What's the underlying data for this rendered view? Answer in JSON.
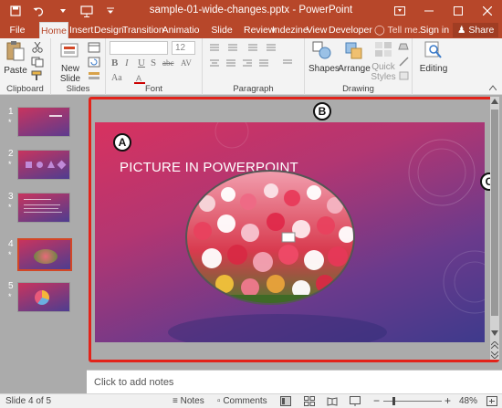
{
  "window": {
    "title": "sample-01-wide-changes.pptx - PowerPoint"
  },
  "tabs": [
    "File",
    "Home",
    "Insert",
    "Design",
    "Transition",
    "Animatio",
    "Slide Shov",
    "Review",
    "Indezine",
    "View",
    "Developer"
  ],
  "tell_me": "Tell me...",
  "sign_in": "Sign in",
  "share": "Share",
  "ribbon": {
    "paste": "Paste",
    "new_slide_line1": "New",
    "new_slide_line2": "Slide",
    "font_size": "12",
    "shapes": "Shapes",
    "arrange": "Arrange",
    "quick_styles_line1": "Quick",
    "quick_styles_line2": "Styles",
    "editing": "Editing",
    "groups": {
      "clipboard": "Clipboard",
      "slides": "Slides",
      "font": "Font",
      "paragraph": "Paragraph",
      "drawing": "Drawing"
    },
    "format_buttons": [
      "B",
      "I",
      "U",
      "S",
      "abc",
      "AV",
      "Aa"
    ]
  },
  "thumbnails": [
    {
      "number": "1",
      "star": "*"
    },
    {
      "number": "2",
      "star": "*"
    },
    {
      "number": "3",
      "star": "*"
    },
    {
      "number": "4",
      "star": "*"
    },
    {
      "number": "5",
      "star": "*"
    }
  ],
  "slide": {
    "title": "PICTURE IN POWERPOINT"
  },
  "callouts": {
    "a": "A",
    "b": "B",
    "c": "C"
  },
  "notes_placeholder": "Click to add notes",
  "status": {
    "slide_info": "Slide 4 of 5",
    "notes": "Notes",
    "comments": "Comments",
    "zoom": "48%"
  },
  "colors": {
    "accent": "#b7472a",
    "highlight_frame": "#e2231a",
    "active_thumb_border": "#d24726"
  }
}
